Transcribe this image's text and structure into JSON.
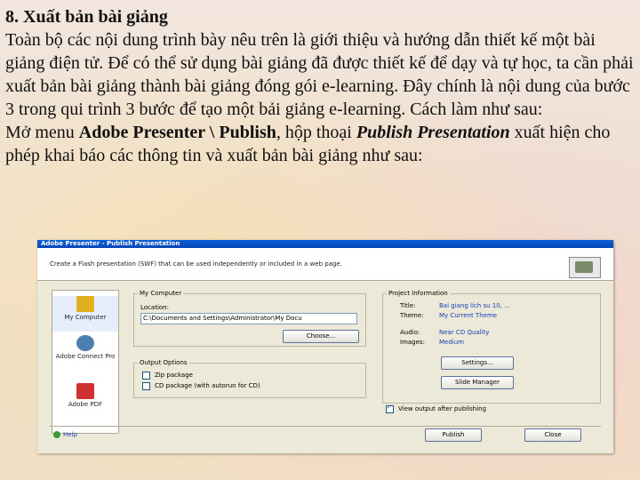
{
  "slide": {
    "heading": "8. Xuất bản bài giảng",
    "paragraph1": "Toàn bộ các nội dung trình bày nêu trên là giới thiệu và hướng dẫn thiết kế một bài giảng điện tử. Để có thể sử dụng bài giảng đã được thiết kế để dạy và tự học, ta cần phải xuất bản bài giảng thành bài giảng đóng gói e-learning. Đây chính là nội dung của bước 3 trong qui trình 3 bước để tạo một bải giảng e-learning. Cách làm như sau:",
    "p2_a": "Mở menu ",
    "p2_menu": "Adobe Presenter \\ Publish",
    "p2_b": ", hộp thoại ",
    "p2_dialog": "Publish Presentation",
    "p2_c": " xuất hiện cho phép khai báo các thông tin và xuất bản bài giảng như sau:"
  },
  "dialog": {
    "title": "Adobe Presenter - Publish Presentation",
    "description": "Create a Flash presentation (SWF) that can be used independently or included in a web page.",
    "nav": [
      {
        "label": "My Computer",
        "icon": "computer-icon",
        "color": "#e0b020"
      },
      {
        "label": "Adobe Connect Pro",
        "icon": "connect-icon",
        "color": "#4a7fb0"
      },
      {
        "label": "Adobe PDF",
        "icon": "pdf-icon",
        "color": "#d03030"
      }
    ],
    "my_computer": {
      "legend": "My Computer",
      "location_label": "Location:",
      "location_value": "C:\\Documents and Settings\\Administrator\\My Docu",
      "choose_button": "Choose..."
    },
    "output": {
      "legend": "Output Options",
      "zip": "Zip package",
      "cd": "CD package (with autorun for CD)"
    },
    "project": {
      "legend": "Project Information",
      "title_label": "Title:",
      "title_value": "Bai giang lich su 10, ...",
      "theme_label": "Theme:",
      "theme_value": "My Current Theme",
      "audio_label": "Audio:",
      "audio_value": "Near CD Quality",
      "images_label": "Images:",
      "images_value": "Medium",
      "settings_button": "Settings...",
      "slide_manager_button": "Slide Manager",
      "view_output": "View output after publishing"
    },
    "help": "Help",
    "publish_button": "Publish",
    "close_button": "Close"
  }
}
